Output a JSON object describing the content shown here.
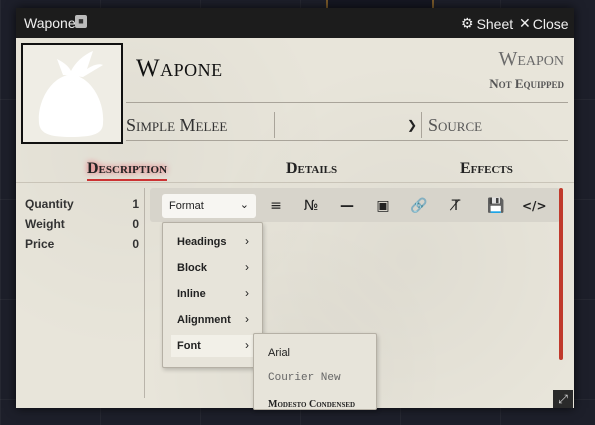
{
  "window": {
    "title": "Wapone",
    "sheet_label": "Sheet",
    "close_label": "Close"
  },
  "item": {
    "name": "Wapone",
    "type": "Weapon",
    "equip_state": "Not Equipped",
    "weapon_type": "Simple Melee",
    "select_value": "",
    "source_label": "Source"
  },
  "tabs": [
    {
      "label": "Description",
      "active": true
    },
    {
      "label": "Details",
      "active": false
    },
    {
      "label": "Effects",
      "active": false
    }
  ],
  "properties": [
    {
      "label": "Quantity",
      "value": "1"
    },
    {
      "label": "Weight",
      "value": "0"
    },
    {
      "label": "Price",
      "value": "0"
    }
  ],
  "editor": {
    "format_label": "Format",
    "toolbar_icons": [
      "bullet-list-icon",
      "numbered-list-icon",
      "horizontal-rule-icon",
      "image-icon",
      "link-icon",
      "clear-format-icon",
      "save-icon",
      "source-code-icon"
    ]
  },
  "format_menu": [
    {
      "label": "Headings"
    },
    {
      "label": "Block"
    },
    {
      "label": "Inline"
    },
    {
      "label": "Alignment"
    },
    {
      "label": "Font"
    }
  ],
  "font_menu": [
    {
      "label": "Arial"
    },
    {
      "label": "Courier New"
    },
    {
      "label": "Modesto Condensed"
    }
  ],
  "colors": {
    "accent": "#c0392b",
    "titlebar": "#1c1c1c",
    "parchment": "#e8e5da"
  }
}
